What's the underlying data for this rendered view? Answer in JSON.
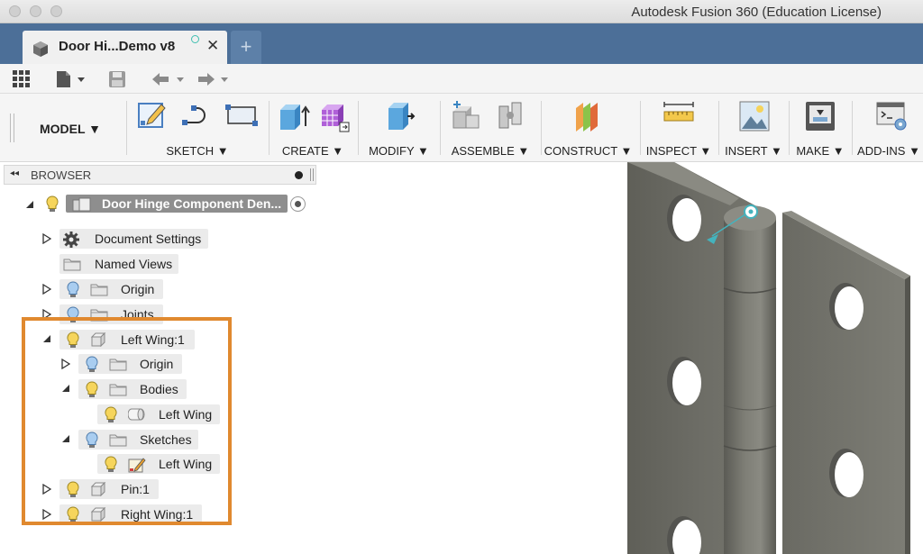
{
  "window": {
    "title": "Autodesk Fusion 360 (Education License)"
  },
  "document_tab": {
    "label": "Door Hi...Demo v8",
    "close": "✕",
    "new_tab": "+"
  },
  "workspace": {
    "label": "MODEL ▼"
  },
  "ribbon": {
    "groups": [
      {
        "id": "sketch",
        "label": "SKETCH ▼"
      },
      {
        "id": "create",
        "label": "CREATE ▼"
      },
      {
        "id": "modify",
        "label": "MODIFY ▼"
      },
      {
        "id": "assemble",
        "label": "ASSEMBLE ▼"
      },
      {
        "id": "construct",
        "label": "CONSTRUCT ▼"
      },
      {
        "id": "inspect",
        "label": "INSPECT ▼"
      },
      {
        "id": "insert",
        "label": "INSERT ▼"
      },
      {
        "id": "make",
        "label": "MAKE ▼"
      },
      {
        "id": "addins",
        "label": "ADD-INS ▼"
      }
    ]
  },
  "browser": {
    "title": "BROWSER",
    "root": {
      "label": "Door Hinge Component Den..."
    },
    "nodes": [
      {
        "label": "Document Settings",
        "icon": "gear-icon",
        "expander": "collapsed"
      },
      {
        "label": "Named Views",
        "icon": "folder-icon",
        "expander": "collapsed"
      },
      {
        "label": "Origin",
        "icon": "folder-icon",
        "expander": "collapsed"
      },
      {
        "label": "Joints",
        "icon": "folder-icon",
        "expander": "collapsed"
      },
      {
        "label": "Left Wing:1",
        "icon": "component-icon",
        "expander": "expanded"
      },
      {
        "label": "Origin",
        "icon": "folder-icon",
        "expander": "collapsed"
      },
      {
        "label": "Bodies",
        "icon": "folder-icon",
        "expander": "expanded"
      },
      {
        "label": "Left Wing",
        "icon": "body-icon",
        "expander": "none"
      },
      {
        "label": "Sketches",
        "icon": "folder-icon",
        "expander": "expanded"
      },
      {
        "label": "Left Wing",
        "icon": "sketch-icon",
        "expander": "none"
      },
      {
        "label": "Pin:1",
        "icon": "component-icon",
        "expander": "collapsed"
      },
      {
        "label": "Right Wing:1",
        "icon": "component-icon",
        "expander": "collapsed"
      }
    ]
  },
  "colors": {
    "tabbar": "#4c6f98",
    "highlight": "#e0892f",
    "hinge_metal": "#6f6f68",
    "selection_pill": "#8e8e8e"
  }
}
